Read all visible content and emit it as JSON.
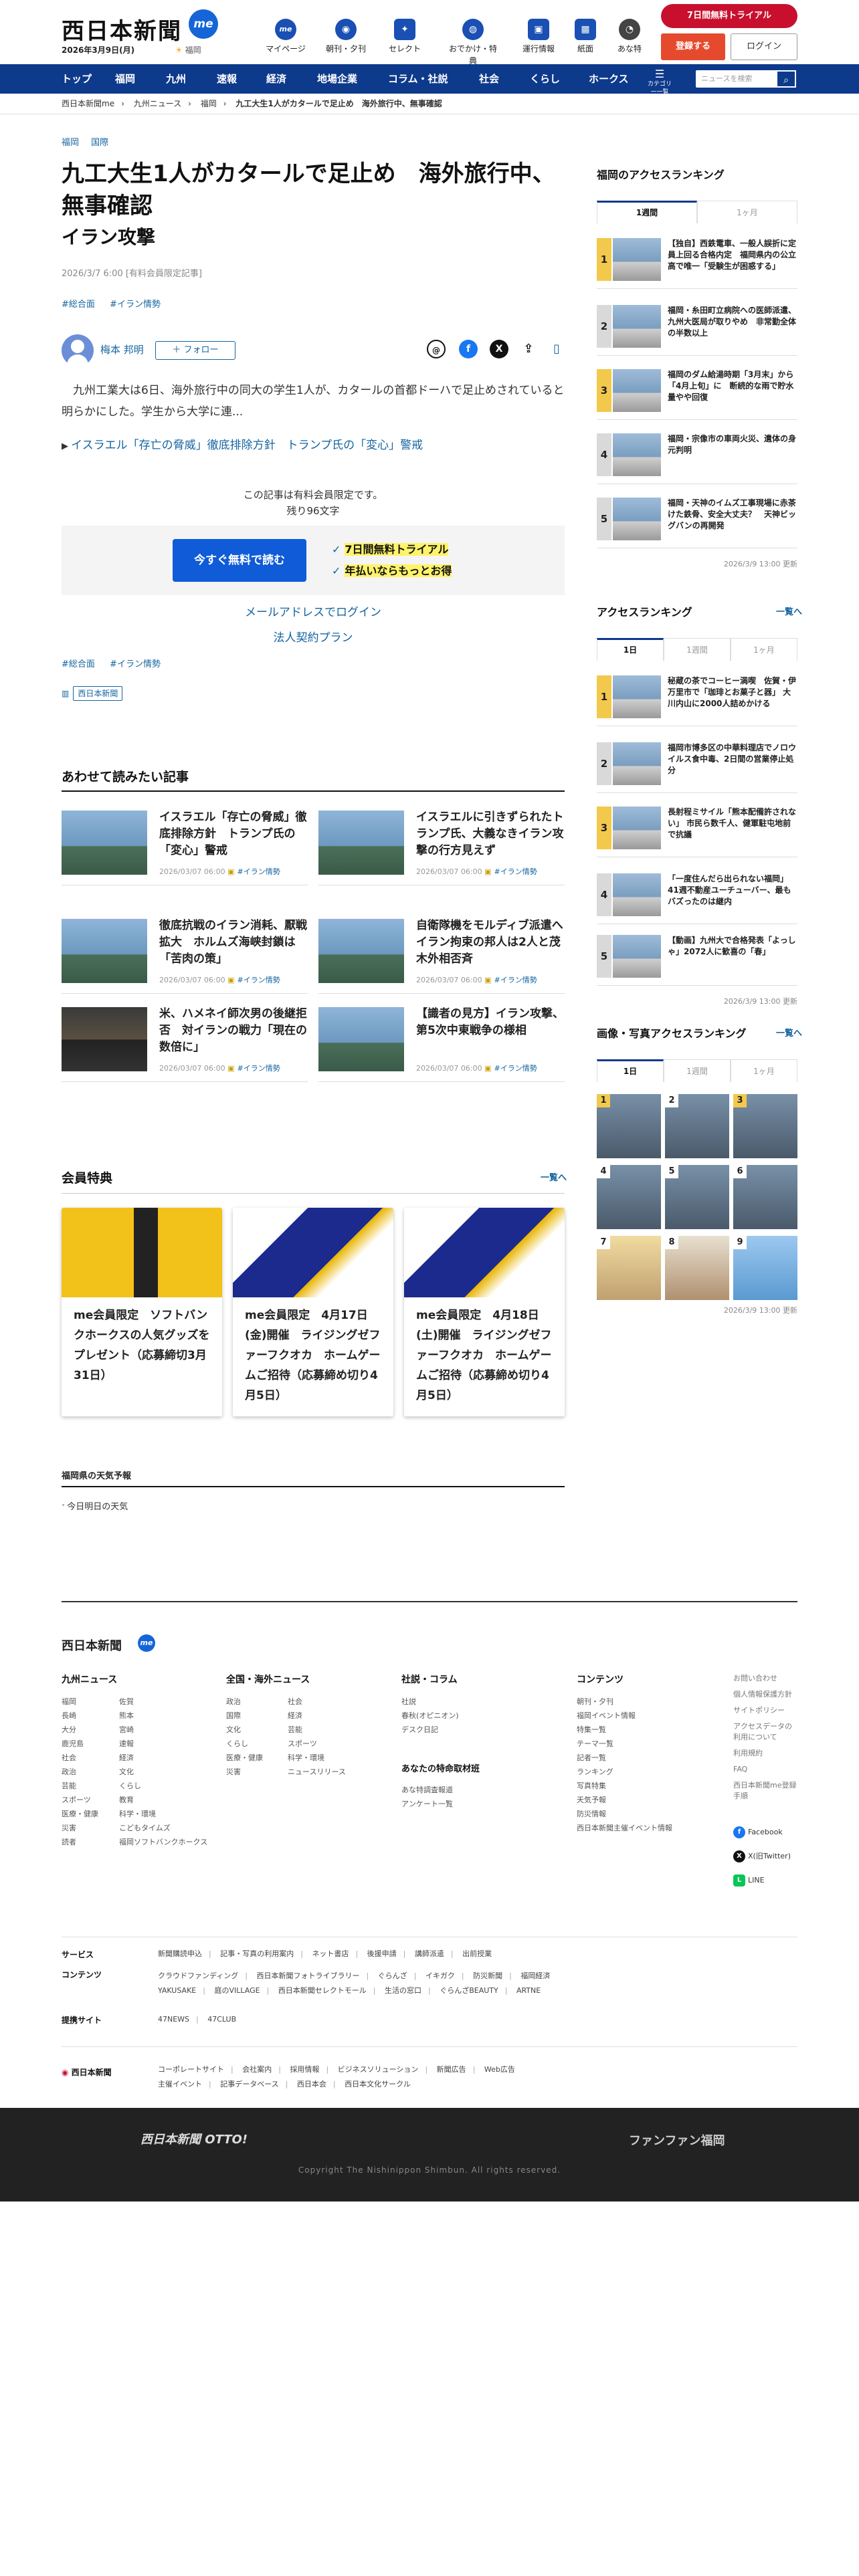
{
  "header": {
    "logo": "西日本新聞",
    "logo_me": "me",
    "date": "2026年3月9日(月)",
    "weather": "福岡",
    "nav": [
      {
        "label": "マイページ",
        "icon": "me"
      },
      {
        "label": "朝刊・夕刊",
        "icon": "◉"
      },
      {
        "label": "セレクト",
        "icon": "✦"
      },
      {
        "label": "おでかけ・特典",
        "icon": "◍"
      },
      {
        "label": "運行情報",
        "icon": "▣"
      },
      {
        "label": "紙面",
        "icon": "▦"
      },
      {
        "label": "あな特",
        "icon": "◔"
      }
    ],
    "trial": "7日間無料トライアル",
    "register": "登録する",
    "login": "ログイン"
  },
  "navbar": {
    "items": [
      "トップ",
      "福岡",
      "九州",
      "速報",
      "経済",
      "地場企業",
      "コラム・社説",
      "社会",
      "くらし",
      "ホークス"
    ],
    "category": "カテゴリー一覧",
    "search_placeholder": "ニュースを検索"
  },
  "breadcrumb": [
    "西日本新聞me",
    "九州ニュース",
    "福岡",
    "九工大生1人がカタールで足止め　海外旅行中、無事確認"
  ],
  "article": {
    "categories": [
      "福岡",
      "国際"
    ],
    "title": "九工大生1人がカタールで足止め　海外旅行中、無事確認",
    "subtitle": "イラン攻撃",
    "pubdate": "2026/3/7 6:00 [有料会員限定記事]",
    "tags": [
      "#総合面",
      "#イラン情勢"
    ],
    "author": "梅本 邦明",
    "follow": "＋ フォロー",
    "lead": "九州工業大は6日、海外旅行中の同大の学生1人が、カタールの首都ドーハで足止めされていると明らかにした。学生から大学に連...",
    "related": "イスラエル「存亡の脅威」徹底排除方針　トランプ氏の「変心」警戒",
    "locked_line1": "この記事は有料会員限定です。",
    "locked_line2": "残り96文字",
    "read_free": "今すぐ無料で読む",
    "benefit1": "7日間無料トライアル",
    "benefit2": "年払いならもっとお得",
    "mail_login": "メールアドレスでログイン",
    "corporate": "法人契約プラン",
    "tags_bottom": [
      "#総合面",
      "#イラン情勢"
    ],
    "publisher": "西日本新聞"
  },
  "recommend": {
    "heading": "あわせて読みたい記事",
    "items": [
      {
        "title": "イスラエル「存亡の脅威」徹底排除方針　トランプ氏の「変心」警戒",
        "date": "2026/03/07 06:00",
        "tag": "#イラン情勢"
      },
      {
        "title": "イスラエルに引きずられたトランプ氏、大義なきイラン攻撃の行方見えず",
        "date": "2026/03/07 06:00",
        "tag": "#イラン情勢"
      },
      {
        "title": "徹底抗戦のイラン消耗、厭戦拡大　ホルムズ海峡封鎖は「苦肉の策」",
        "date": "2026/03/07 06:00",
        "tag": "#イラン情勢"
      },
      {
        "title": "自衛隊機をモルディブ派遣へ　イラン拘束の邦人は2人と茂木外相否斉",
        "date": "2026/03/07 06:00",
        "tag": "#イラン情勢"
      },
      {
        "title": "米、ハメネイ師次男の後継拒否　対イランの戦力「現在の数倍に」",
        "date": "2026/03/07 06:00",
        "tag": "#イラン情勢"
      },
      {
        "title": "【識者の見方】イラン攻撃、第5次中東戦争の様相",
        "date": "2026/03/07 06:00",
        "tag": "#イラン情勢"
      }
    ]
  },
  "member": {
    "heading": "会員特典",
    "more": "一覧へ",
    "items": [
      {
        "title": "me会員限定　ソフトバンクホークスの人気グッズをプレゼント（応募締切3月31日）"
      },
      {
        "title": "me会員限定　4月17日(金)開催　ライジングゼファーフクオカ　ホームゲームご招待（応募締め切り4月5日）"
      },
      {
        "title": "me会員限定　4月18日(土)開催　ライジングゼファーフクオカ　ホームゲームご招待（応募締め切り4月5日）"
      }
    ]
  },
  "weather": {
    "heading": "福岡県の天気予報",
    "sub": "今日明日の天気"
  },
  "sidebar": {
    "access_fukuoka": {
      "heading": "福岡のアクセスランキング",
      "tabs": [
        "1週間",
        "1ヶ月"
      ],
      "items": [
        "【独自】西鉄電車、一般人誤折に定員上回る合格内定　福岡県内の公立高で唯一「受験生が困惑する」",
        "福岡・糸田町立病院への医師派遣、九州大医局が取りやめ　非常勤全体の半数以上",
        "福岡のダム給湯時期「3月末」から「4月上旬」に　断続的な雨で貯水量やや回復",
        "福岡・宗像市の車両火災、遺体の身元判明",
        "福岡・天神のイムズ工事現場に赤茶けた鉄骨、安全大丈夫？　天神ビッグバンの再開発"
      ],
      "updated": "2026/3/9 13:00 更新"
    },
    "access": {
      "heading": "アクセスランキング",
      "more": "一覧へ",
      "tabs": [
        "1日",
        "1週間",
        "1ヶ月"
      ],
      "items": [
        "秘蔵の茶でコーヒー満喫　佐賀・伊万里市で「珈琲とお菓子と器」 大川内山に2000人詰めかける",
        "福岡市博多区の中華料理店でノロウイルス食中毒、2日間の営業停止処分",
        "長射程ミサイル「熊本配備許されない」 市民ら数千人、健軍駐屯地前で抗議",
        "「一度住んだら出られない福岡」41週不動産ユーチューバー、最もバズったのは継内",
        "【動画】九州大で合格発表「よっしゃ」2072人に歓喜の「春」"
      ],
      "updated": "2026/3/9 13:00 更新"
    },
    "photo": {
      "heading": "画像・写真アクセスランキング",
      "more": "一覧へ",
      "tabs": [
        "1日",
        "1週間",
        "1ヶ月"
      ],
      "numbers": [
        "1",
        "2",
        "3",
        "4",
        "5",
        "6",
        "7",
        "8",
        "9"
      ],
      "updated": "2026/3/9 13:00 更新"
    }
  },
  "footer": {
    "logo": "西日本新聞",
    "cols": [
      {
        "heading": "九州ニュース",
        "items": [
          "福岡",
          "佐賀",
          "長崎",
          "熊本",
          "大分",
          "宮崎",
          "鹿児島",
          "速報",
          "社会",
          "経済",
          "政治",
          "文化",
          "芸能",
          "くらし",
          "スポーツ",
          "教育",
          "医療・健康",
          "科学・環境",
          "災害",
          "こどもタイムズ",
          "読者",
          "福岡ソフトバンクホークス"
        ]
      },
      {
        "heading": "全国・海外ニュース",
        "items": [
          "政治",
          "社会",
          "国際",
          "経済",
          "文化",
          "芸能",
          "くらし",
          "スポーツ",
          "医療・健康",
          "科学・環境",
          "災害",
          "ニュースリリース"
        ]
      },
      {
        "heading": "社説・コラム",
        "items": [
          "社説",
          "春秋(オピニオン)",
          "デスク日記"
        ],
        "sub_heading": "あなたの特命取材班",
        "sub_items": [
          "あな特調査報道",
          "アンケート一覧"
        ]
      },
      {
        "heading": "コンテンツ",
        "items": [
          "朝刊・夕刊",
          "福岡イベント情報",
          "特集一覧",
          "テーマ一覧",
          "記者一覧",
          "ランキング",
          "写真特集",
          "天気予報",
          "防災情報",
          "西日本新聞主催イベント情報"
        ]
      }
    ],
    "right_links": [
      "お問い合わせ",
      "個人情報保護方針",
      "サイトポリシー",
      "アクセスデータの利用について",
      "利用規約",
      "FAQ",
      "西日本新聞me登録手順"
    ],
    "sns": [
      "Facebook",
      "X(旧Twitter)",
      "LINE"
    ],
    "services": [
      {
        "label": "サービス",
        "items": [
          "新聞購読申込",
          "記事・写真の利用案内",
          "ネット書店",
          "後援申請",
          "講師派遣",
          "出前授業"
        ]
      },
      {
        "label": "コンテンツ",
        "items": [
          "クラウドファンディング",
          "西日本新聞フォトライブラリー",
          "ぐらんざ",
          "イキガク",
          "防災新聞",
          "福岡経済",
          "YAKUSAKE",
          "庭のVILLAGE",
          "西日本新聞セレクトモール",
          "生活の窓口",
          "ぐらんざBEAUTY",
          "ARTNE"
        ]
      },
      {
        "label": "提携サイト",
        "items": [
          "47NEWS",
          "47CLUB"
        ]
      }
    ],
    "corp_logo": "西日本新聞",
    "corp_links": [
      "コーポレートサイト",
      "会社案内",
      "採用情報",
      "ビジネスソリューション",
      "新聞広告",
      "Web広告",
      "主催イベント",
      "記事データベース",
      "西日本会",
      "西日本文化サークル"
    ],
    "otto": "西日本新聞 OTTO!",
    "fanfan": "ファンファン福岡",
    "copyright": "Copyright The Nishinippon Shimbun. All rights reserved."
  }
}
